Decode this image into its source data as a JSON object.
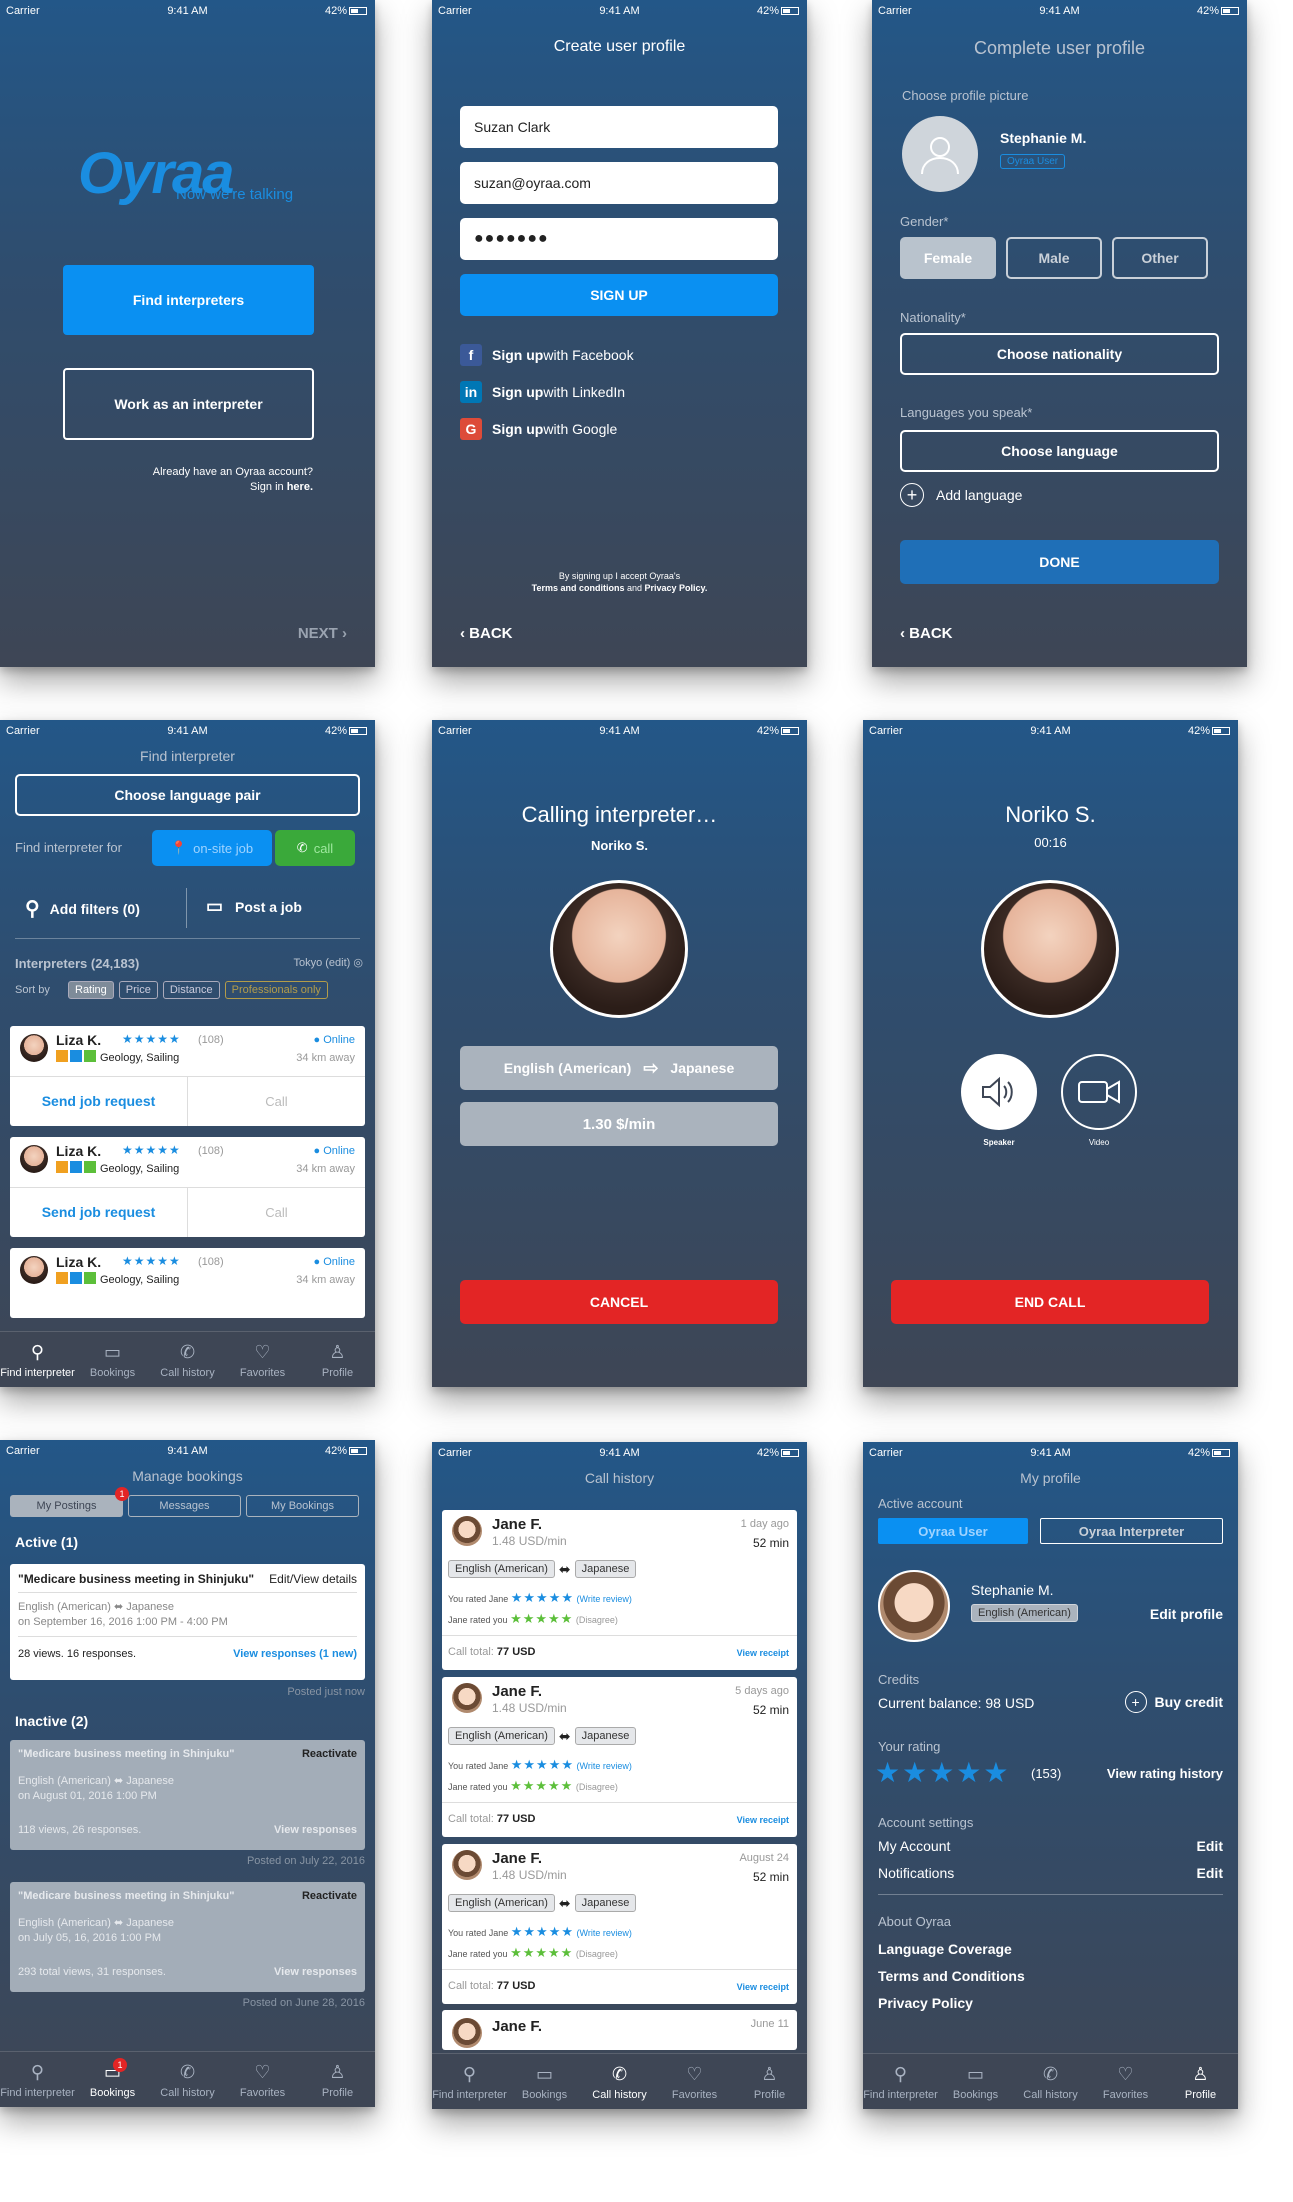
{
  "status": {
    "carrier": "Carrier",
    "time": "9:41 AM",
    "battery": "42%"
  },
  "s1": {
    "logo": "Oyraa",
    "tagline": "Now we're talking",
    "find": "Find interpreters",
    "work": "Work as an interpreter",
    "account1": "Already have an Oyraa account?",
    "account2": "Sign in ",
    "here": "here.",
    "next": "NEXT"
  },
  "s2": {
    "title": "Create user profile",
    "name": "Suzan Clark",
    "email": "suzan@oyraa.com",
    "password": "●●●●●●●",
    "signup": "SIGN UP",
    "fb": "Sign up",
    "fb2": " with Facebook",
    "li": "Sign up",
    "li2": " with LinkedIn",
    "gg": "Sign up",
    "gg2": " with Google",
    "terms1": "By signing up I accept Oyraa's",
    "terms2": "Terms and conditions",
    "and": " and ",
    "privacy": "Privacy Policy.",
    "back": "BACK"
  },
  "s3": {
    "title": "Complete user profile",
    "choose_pic": "Choose profile picture",
    "name": "Stephanie M.",
    "badge": "Oyraa User",
    "gender": "Gender*",
    "female": "Female",
    "male": "Male",
    "other": "Other",
    "nationality": "Nationality*",
    "choose_nat": "Choose nationality",
    "languages": "Languages you speak*",
    "choose_lang": "Choose language",
    "add_lang": "Add language",
    "done": "DONE",
    "back": "BACK"
  },
  "s4": {
    "title": "Find interpreter",
    "lang_pair": "Choose language pair",
    "find_for": "Find interpreter for",
    "onsite": "on-site job",
    "call": "call",
    "filters": "Add filters (0)",
    "post": "Post a job",
    "interpreters": "Interpreters (24,183)",
    "location": "Tokyo (edit)",
    "sort": "Sort by",
    "sorts": [
      "Rating",
      "Price",
      "Distance",
      "Professionals only"
    ],
    "items": [
      {
        "name": "Liza K.",
        "count": "(108)",
        "online": "Online",
        "tags": "Geology, Sailing",
        "dist": "34 km away",
        "send": "Send job request",
        "callb": "Call"
      },
      {
        "name": "Liza K.",
        "count": "(108)",
        "online": "Online",
        "tags": "Geology, Sailing",
        "dist": "34 km away",
        "send": "Send job request",
        "callb": "Call"
      },
      {
        "name": "Liza K.",
        "count": "(108)",
        "online": "Online",
        "tags": "Geology, Sailing",
        "dist": "34 km away"
      }
    ]
  },
  "tabs": {
    "find": "Find interpreter",
    "bookings": "Bookings",
    "history": "Call history",
    "favorites": "Favorites",
    "profile": "Profile"
  },
  "s5": {
    "title": "Calling interpreter…",
    "name": "Noriko S.",
    "from": "English (American)",
    "to": "Japanese",
    "rate": "1.30 $/min",
    "cancel": "CANCEL"
  },
  "s6": {
    "name": "Noriko S.",
    "time": "00:16",
    "speaker": "Speaker",
    "video": "Video",
    "end": "END CALL"
  },
  "s7": {
    "title": "Manage bookings",
    "tab1": "My Postings",
    "tab2": "Messages",
    "tab3": "My Bookings",
    "badge": "1",
    "active": "Active (1)",
    "a_title": "\"Medicare business meeting in Shinjuku\"",
    "edit": "Edit/View details",
    "a_lang": "English (American)",
    "a_lang2": "Japanese",
    "a_date": "on September 16, 2016 1:00 PM - 4:00 PM",
    "a_views": "28 views. 16 responses.",
    "a_resp": "View responses (1 new)",
    "posted0": "Posted just now",
    "inactive": "Inactive (2)",
    "inact": [
      {
        "title": "\"Medicare business meeting in Shinjuku\"",
        "react": "Reactivate",
        "lang": "English (American)",
        "lang2": "Japanese",
        "date": "on August 01, 2016 1:00 PM",
        "views": "118 views, 26 responses.",
        "resp": "View responses",
        "posted": "Posted on July 22, 2016"
      },
      {
        "title": "\"Medicare business meeting in Shinjuku\"",
        "react": "Reactivate",
        "lang": "English (American)",
        "lang2": "Japanese",
        "date": "on July 05, 16, 2016 1:00 PM",
        "views": "293 total views, 31 responses.",
        "resp": "View responses",
        "posted": "Posted on June 28, 2016"
      }
    ]
  },
  "s8": {
    "title": "Call history",
    "items": [
      {
        "name": "Jane F.",
        "rate": "1.48 USD/min",
        "when": "1 day ago",
        "dur": "52 min",
        "from": "English (American)",
        "to": "Japanese",
        "you": "You rated Jane",
        "write": "(Write review)",
        "jane": "Jane rated you",
        "dis": "(Disagree)",
        "total": "Call total:",
        "usd": "77 USD",
        "receipt": "View receipt"
      },
      {
        "name": "Jane F.",
        "rate": "1.48 USD/min",
        "when": "5 days ago",
        "dur": "52 min",
        "from": "English (American)",
        "to": "Japanese",
        "you": "You rated Jane",
        "write": "(Write review)",
        "jane": "Jane rated you",
        "dis": "(Disagree)",
        "total": "Call total:",
        "usd": "77 USD",
        "receipt": "View receipt"
      },
      {
        "name": "Jane F.",
        "rate": "1.48 USD/min",
        "when": "August 24",
        "dur": "52 min",
        "from": "English (American)",
        "to": "Japanese",
        "you": "You rated Jane",
        "write": "(Write review)",
        "jane": "Jane rated you",
        "dis": "(Disagree)",
        "total": "Call total:",
        "usd": "77 USD",
        "receipt": "View receipt"
      }
    ],
    "last_name": "Jane F.",
    "last_when": "June 11"
  },
  "s9": {
    "title": "My profile",
    "active": "Active account",
    "user": "Oyraa User",
    "interp": "Oyraa Interpreter",
    "name": "Stephanie M.",
    "lang": "English (American)",
    "edit": "Edit profile",
    "credits": "Credits",
    "balance": "Current balance: 98 USD",
    "buy": "Buy credit",
    "rating": "Your rating",
    "count": "(153)",
    "view_rating": "View rating history",
    "acct": "Account settings",
    "my": "My Account",
    "notif": "Notifications",
    "edit1": "Edit",
    "edit2": "Edit",
    "about": "About Oyraa",
    "cov": "Language Coverage",
    "terms": "Terms and Conditions",
    "priv": "Privacy Policy"
  },
  "colors": {
    "accent": "#1a8de0",
    "red": "#e32525",
    "green": "#5cbf3a"
  }
}
